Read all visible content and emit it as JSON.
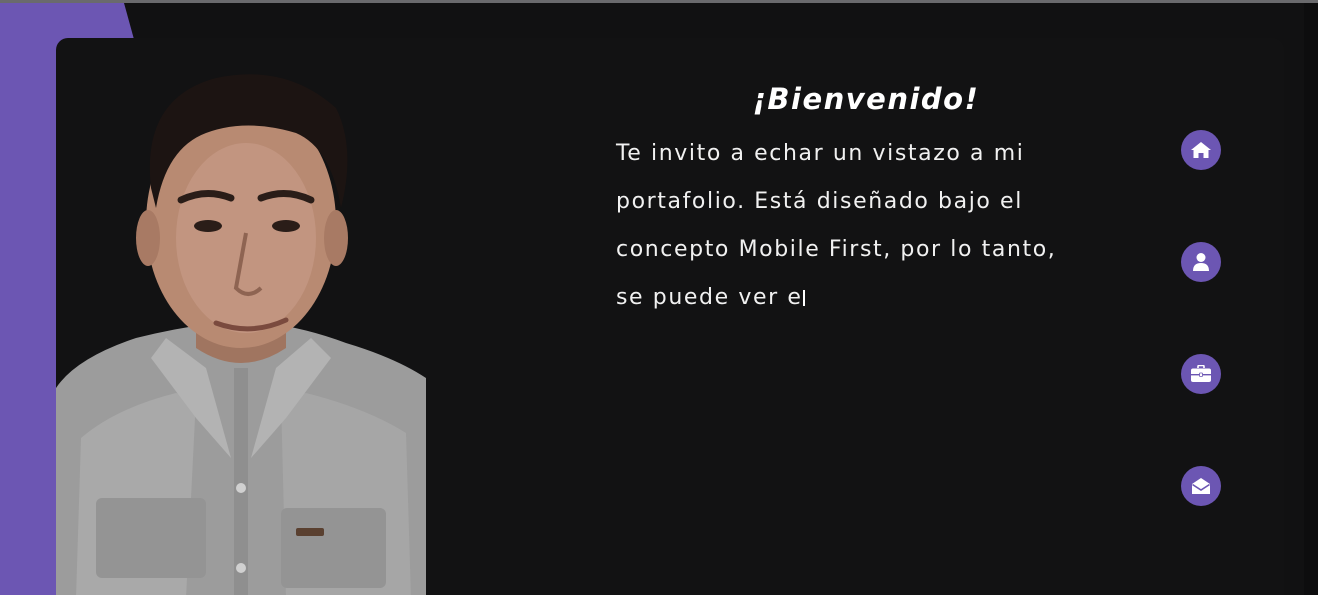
{
  "welcome": {
    "title": "¡Bienvenido!",
    "text": "Te invito a echar un vistazo a mi portafolio. Está diseñado bajo el concepto Mobile First, por lo tanto, se puede ver e"
  },
  "nav": {
    "items": [
      {
        "icon": "home-icon"
      },
      {
        "icon": "user-icon"
      },
      {
        "icon": "briefcase-icon"
      },
      {
        "icon": "envelope-open-icon"
      }
    ]
  },
  "colors": {
    "accent": "#6c56b3",
    "background": "#111112",
    "text": "#ffffff"
  }
}
